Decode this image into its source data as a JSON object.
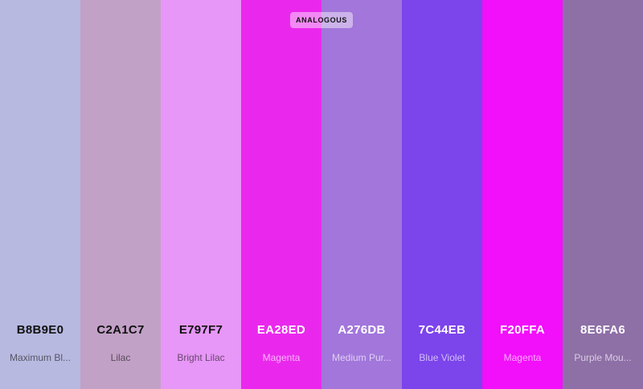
{
  "badge": "ANALOGOUS",
  "swatches": [
    {
      "hex": "B8B9E0",
      "name": "Maximum Bl...",
      "color": "#B8B9E0"
    },
    {
      "hex": "C2A1C7",
      "name": "Lilac",
      "color": "#C2A1C7"
    },
    {
      "hex": "E797F7",
      "name": "Bright Lilac",
      "color": "#E797F7"
    },
    {
      "hex": "EA28ED",
      "name": "Magenta",
      "color": "#EA28ED"
    },
    {
      "hex": "A276DB",
      "name": "Medium Pur...",
      "color": "#A276DB"
    },
    {
      "hex": "7C44EB",
      "name": "Blue Violet",
      "color": "#7C44EB"
    },
    {
      "hex": "F20FFA",
      "name": "Magenta",
      "color": "#F20FFA"
    },
    {
      "hex": "8E6FA6",
      "name": "Purple Mou...",
      "color": "#8E6FA6"
    }
  ]
}
